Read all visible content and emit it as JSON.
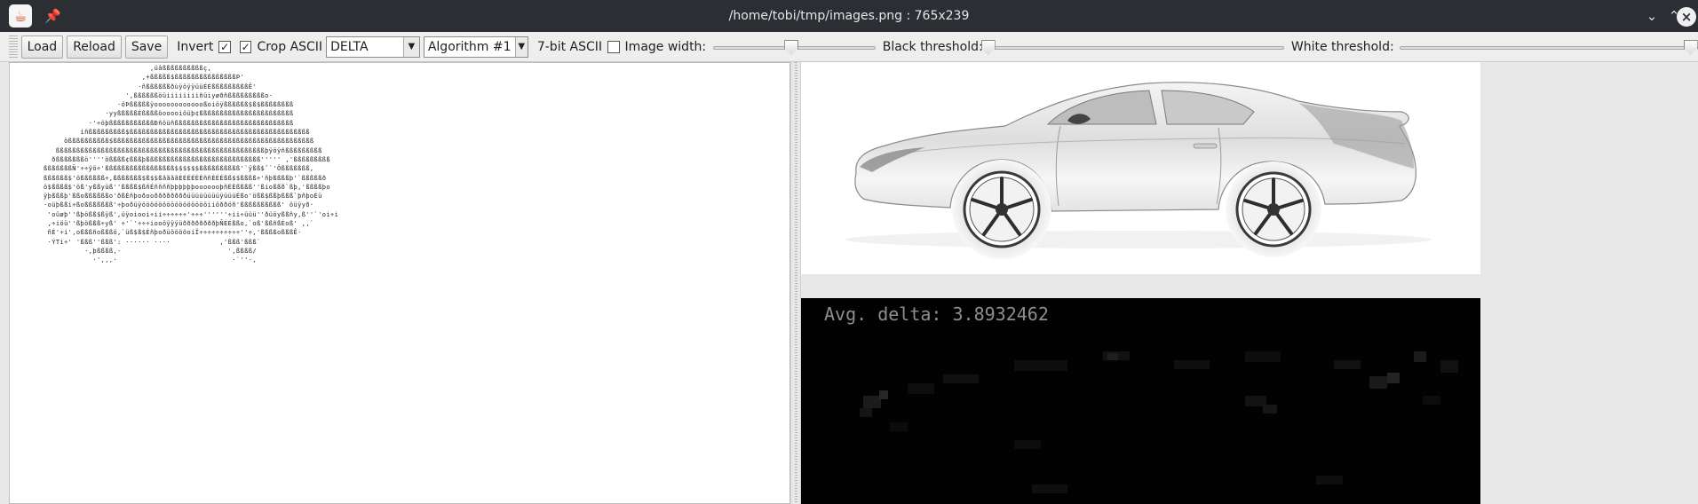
{
  "window": {
    "title": "/home/tobi/tmp/images.png : 765x239"
  },
  "toolbar": {
    "load_label": "Load",
    "reload_label": "Reload",
    "save_label": "Save",
    "invert_label": "Invert",
    "invert_checked": true,
    "crop_ascii_label": "Crop ASCII",
    "crop_ascii_checked": true,
    "mode_value": "DELTA",
    "algorithm_value": "Algorithm #1",
    "seven_bit_label": "7-bit ASCII",
    "seven_bit_checked": false,
    "image_width_label": "Image width:",
    "image_width_level": 0.48,
    "black_threshold_label": "Black threshold:",
    "black_threshold_level": 0.0,
    "white_threshold_label": "White threshold:",
    "white_threshold_level": 1.0
  },
  "ascii_art": [
    "                          ,üâßßßßßßßßßßç,",
    "                        ,+ßßßßß$ßßßßßßßßßßßßßßßÞ'",
    "                       ·ñßßßßßßðùÿöÿÿüüÉÉßßßßßßßßßÊ'",
    "                    ',ßßßßßßöüiiiiiiiiñüiyøðñßßßßßßßßßo·",
    "                  ·öÞßßßßßÿooooooooooooßoiöÿßßßßßß$ß$ßßßßßßßß",
    "               ·yyßßßßßÉßßßßöooooiöüþ¢ßßßßßßßßßßßßßßßßßßßßßßß",
    "           ·'÷öþßßßßßßßßßßßÐñöüñßßßßßßßßßßßßßßßßßßßßßßßßßßßßß",
    "         iñßßßßßßßßß$ßßßßßßßßßßßßßßßßßßßßßßßßßßßßßßßßßßßßßßßßßßßß",
    "     ößßßßßßßßßß$ßßßßßßßßßßßßßßßßßßßßßßßßßßßßßßßßßßßßßßßßßßßßßßßßß",
    "   ßßßßßßßßßßßßßßßßßßßßßßßßßßßßßßßßßßßßßßßßßßßßßßßßßßßþÿöÿñßßßßßßßßß",
    "  ðßßßßßßßö''''ößßßß¢ßßßþßßßßßßßßßßßßßßßßßßßßßßßßßßßß''''' ,'ßßßßßßßßß",
    "ßßßßßßßÑ'÷÷ÿö÷'ßßßßßßßßßßßßßßßßß$$$$$$ßßßßßßßßßß'`ÿßß$ˆ`'Ôßßßßßßß,",
    "ßßßßßß$'ößßßßßß÷,ßßßßßßß$ß$$ßããããÉÉÉÉÉÉññÉÉÉßß$$ßßßß÷'ñþßßßßþ'`ßßßßßð",
    "ö$ßßßß$'öß'yßßyüß''ßßßß$ßñÉññññþþþþþþooooooþñÉÉßßßß''ßioßßð`ßþ,'ßßßßþo",
    "ÿþßßßþ'ßßoßßßßßßo'ðßÉñþoðooððððððððüüüüüüüüÿüüüÉßo'ößß$ßßþßßß`þñþoÉü",
    "·oüþßßi÷ßoßßßßßßß'÷þoðüÿööööööööööööööööiiöððöñ'ßßßßßßßßßß' öüÿyð·",
    " 'oüøþ''ßþößß$ßÿß',üÿoiooi÷ii÷÷÷÷÷÷'÷÷÷''''''÷ii÷üüü''ðüöyßßñy,ß''`'oi÷i",
    " ,÷iöü''ßþößßß÷yß' ÷'`'÷÷÷iooöÿÿÿüððððððððþÑÉÉßßo,`oß'ßßñßÉoß' ,,`",
    " ñÉ'÷i',oßßßñoßßßö,`üß$ß$ÉñþoðüööööoiÏ÷÷÷÷÷÷÷÷÷÷''÷,'ßßßßoßßßÊ·",
    " ·ÝTi÷' 'ßßß''ßßß': ······ ····            ,'ßßß'ßßß`",
    "          ·,þßßßß,·                          ',ßßßß/",
    "            ·',,,·                            ·`''·,"
  ],
  "delta_label": "Avg. delta: 3.8932462"
}
